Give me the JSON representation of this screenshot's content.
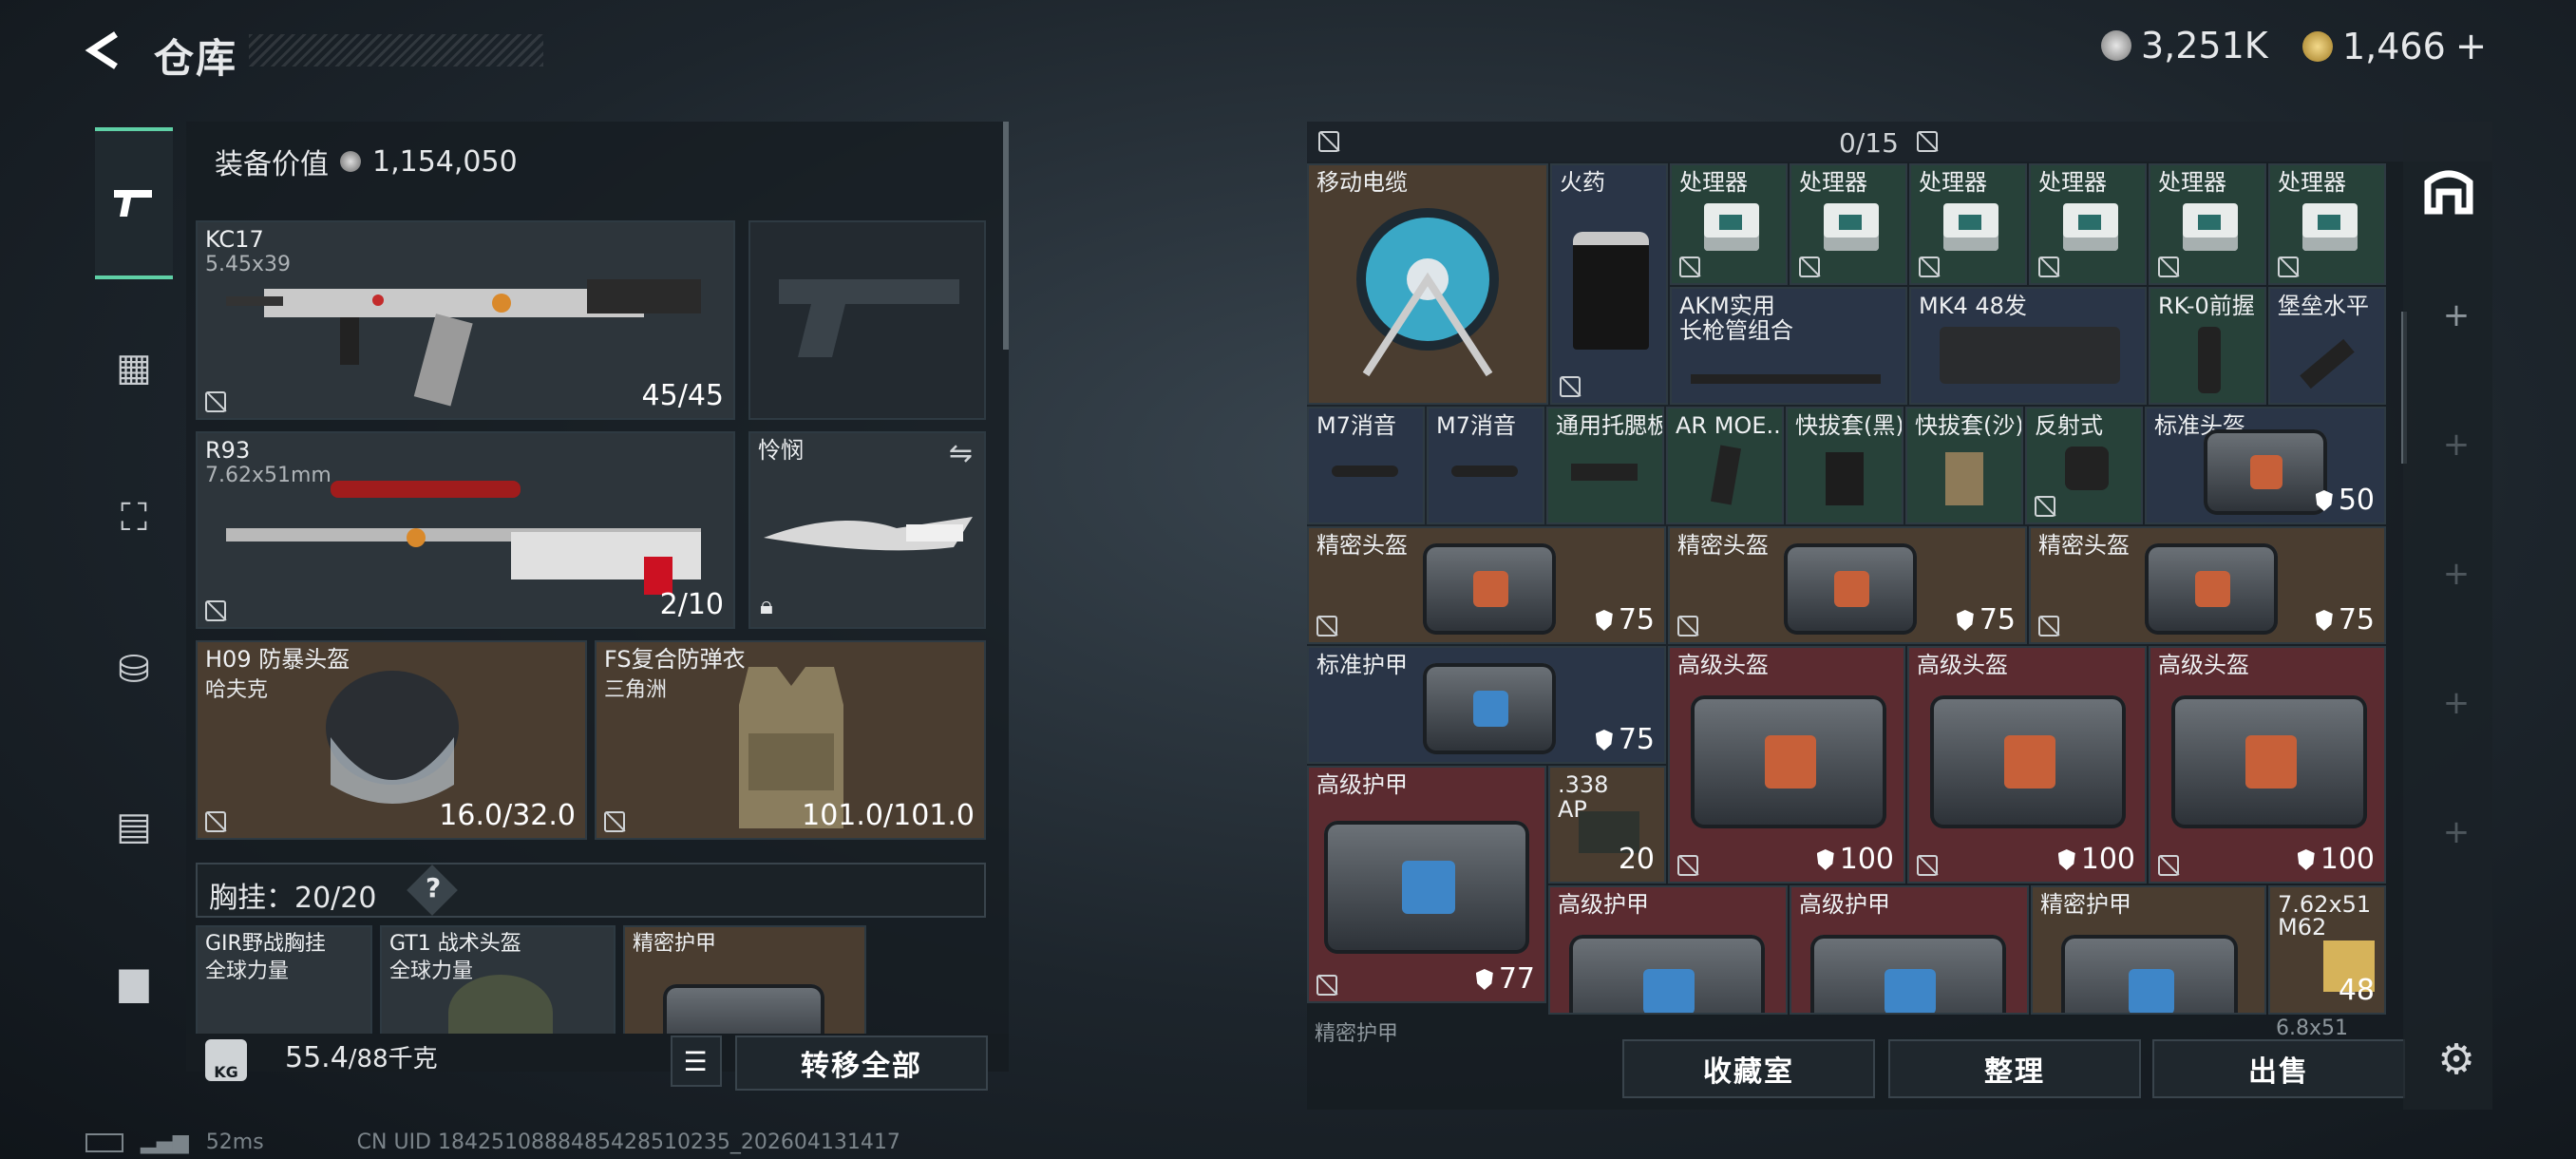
{
  "header": {
    "title": "仓库",
    "currency_1": "3,251K",
    "currency_2": "1,466",
    "add_symbol": "+"
  },
  "loadout": {
    "value_label": "装备价值",
    "value": "1,154,050",
    "primary": {
      "name": "KC17",
      "ammo": "5.45x39",
      "count": "45/45"
    },
    "secondary": {
      "name": "R93",
      "ammo": "7.62x51mm",
      "count": "2/10"
    },
    "melee": {
      "name": "怜悯"
    },
    "helmet": {
      "name": "H09 防暴头盔",
      "maker": "哈夫克",
      "durability": "16.0/32.0"
    },
    "armor": {
      "name": "FS复合防弹衣",
      "maker": "三角洲",
      "durability": "101.0/101.0"
    },
    "rig_label": "胸挂：20/20",
    "rig_help": "?",
    "rig_items": [
      {
        "name": "GIR野战胸挂",
        "sub": "全球力量"
      },
      {
        "name": "GT1 战术头盔",
        "sub": "全球力量"
      },
      {
        "name": "精密护甲"
      }
    ],
    "weight_icon": "KG",
    "weight": "55.4",
    "weight_max": "/88千克",
    "transfer_all": "转移全部"
  },
  "stash": {
    "capacity": "0/15",
    "items": {
      "cable": "移动电缆",
      "powder": "火药",
      "processor": "处理器",
      "akm": "AKM实用",
      "akm2": "长枪管组合",
      "mk4": "MK4 48发",
      "rk0": "RK-0前握",
      "bastion": "堡垒水平",
      "m7": "M7消音",
      "tray": "通用托腮板",
      "armoe": "AR MOE...",
      "quick_black": "快拔套(黑)",
      "quick_sand": "快拔套(沙)",
      "reflex": "反射式",
      "std_helmet": "标准头盔",
      "std_helmet_val": "50",
      "prec_helmet": "精密头盔",
      "val75": "75",
      "std_armor": "标准护甲",
      "adv_helmet": "高级头盔",
      "val100": "100",
      "adv_armor": "高级护甲",
      "val77": "77",
      "ap338": ".338",
      "ap338b": "AP",
      "ap_count": "20",
      "prec_armor": "精密护甲",
      "m62": "7.62x51",
      "m62b": "M62",
      "m62_count": "48",
      "bottom1": "精密护甲",
      "bottom2": "6.8x51"
    },
    "buttons": {
      "collection": "收藏室",
      "sort": "整理",
      "sell": "出售"
    }
  },
  "status": {
    "ping": "52ms",
    "uid": "CN UID 1842510888485428510235_202604131417"
  },
  "colors": {
    "accent": "#5fd0a6",
    "panel": "#161c21"
  }
}
